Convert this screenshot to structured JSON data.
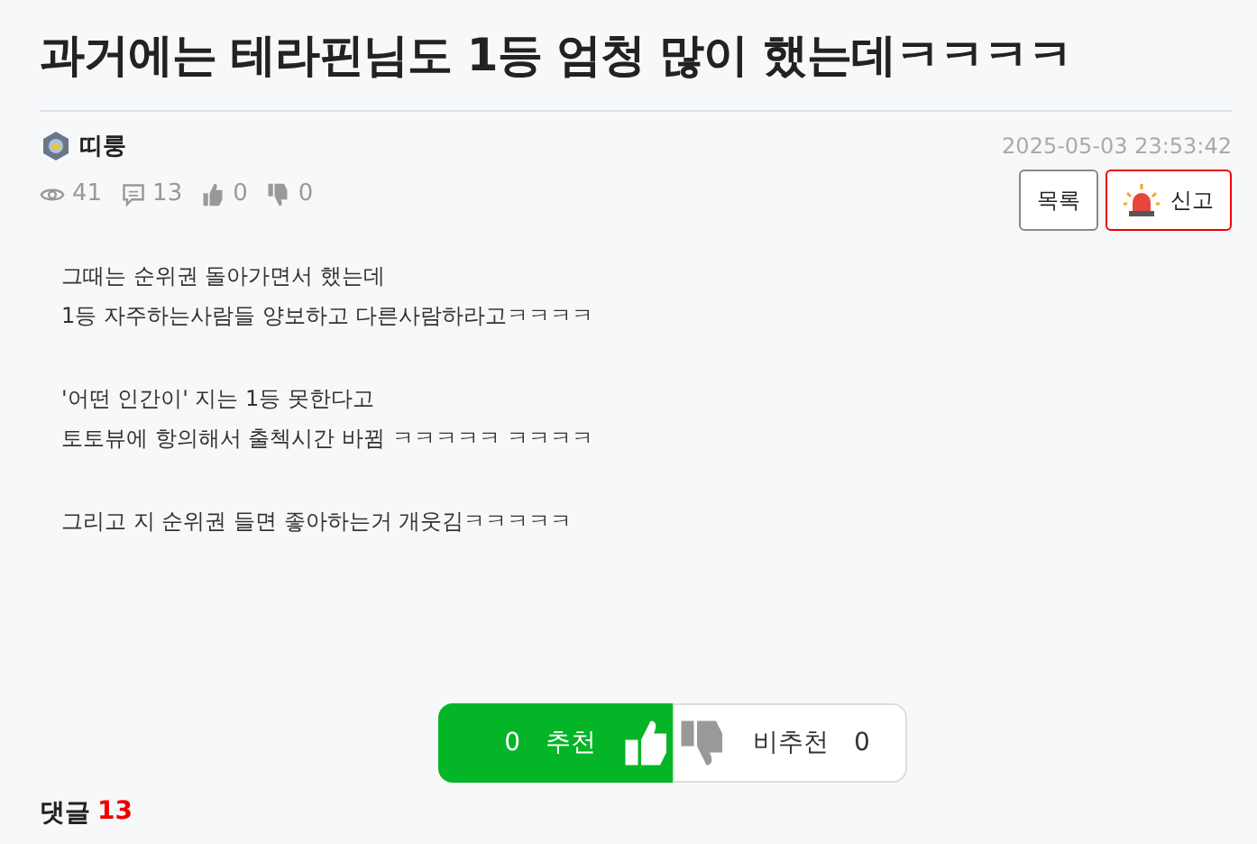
{
  "title": "과거에는 테라핀님도 1등 엄청 많이 했는데ㅋㅋㅋㅋ",
  "author": {
    "name": "띠룽"
  },
  "date": "2025-05-03 23:53:42",
  "stats": [
    {
      "kind": "views",
      "value": "41"
    },
    {
      "kind": "comments",
      "value": "13"
    },
    {
      "kind": "likes",
      "value": "0"
    },
    {
      "kind": "dislikes",
      "value": "0"
    }
  ],
  "actions": [
    {
      "kind": "list",
      "label": "목록"
    },
    {
      "kind": "report",
      "label": "신고"
    }
  ],
  "body": [
    [
      "그때는 순위권 돌아가면서 했는데",
      "1등 자주하는사람들 양보하고 다른사람하라고ㅋㅋㅋㅋ"
    ],
    [
      "'어떤 인간이' 지는 1등 못한다고",
      "토토뷰에 항의해서 출첵시간 바뀜 ㅋㅋㅋㅋㅋ ㅋㅋㅋㅋ"
    ],
    [
      "그리고 지 순위권 들면 좋아하는거 개웃김ㅋㅋㅋㅋㅋ"
    ]
  ],
  "vote": {
    "up": {
      "count": "0",
      "label": "추천"
    },
    "down": {
      "count": "0",
      "label": "비추천"
    }
  },
  "comments": {
    "label": "댓글",
    "count": "13"
  }
}
